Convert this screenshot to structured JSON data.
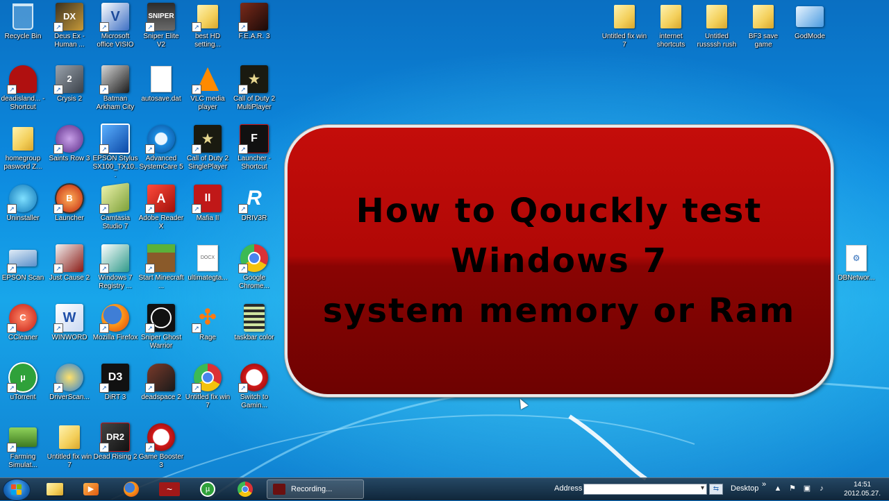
{
  "desktop": {
    "banner_lines": [
      "How to Qouckly test",
      "Windows 7",
      "system memory or Ram"
    ],
    "icons": [
      {
        "label": "Recycle Bin",
        "icon": "recycle-bin-icon"
      },
      {
        "label": "Deus Ex - Human ...",
        "icon": "deus-ex-icon"
      },
      {
        "label": "Microsoft office VISIO",
        "icon": "visio-icon"
      },
      {
        "label": "Sniper Elite V2",
        "icon": "sniper-elite-icon"
      },
      {
        "label": "best HD setting...",
        "icon": "folder-icon"
      },
      {
        "label": "F.E.A.R. 3",
        "icon": "fear3-icon"
      },
      {
        "label": "deadisland... - Shortcut",
        "icon": "deadisland-icon"
      },
      {
        "label": "Crysis 2",
        "icon": "crysis2-icon"
      },
      {
        "label": "Batman Arkham City",
        "icon": "batman-icon"
      },
      {
        "label": "autosave.dat",
        "icon": "file-icon"
      },
      {
        "label": "VLC media player",
        "icon": "vlc-icon"
      },
      {
        "label": "Call of Duty 2 MultiPlayer",
        "icon": "cod2-icon"
      },
      {
        "label": "homegroup pasword Z...",
        "icon": "folder-icon"
      },
      {
        "label": "Saints Row 3",
        "icon": "saints-row-icon"
      },
      {
        "label": "EPSON Stylus SX100_TX10...",
        "icon": "epson-icon"
      },
      {
        "label": "Advanced SystemCare 5",
        "icon": "systemcare-icon"
      },
      {
        "label": "Call of Duty 2 SinglePlayer",
        "icon": "cod2-icon"
      },
      {
        "label": "Launcher - Shortcut",
        "icon": "launcher-icon"
      },
      {
        "label": "Uninstaller",
        "icon": "uninstaller-icon"
      },
      {
        "label": "Launcher",
        "icon": "launcher-icon"
      },
      {
        "label": "Camtasia Studio 7",
        "icon": "camtasia-icon"
      },
      {
        "label": "Adobe Reader X",
        "icon": "adobe-reader-icon"
      },
      {
        "label": "Mafia II",
        "icon": "mafia-icon"
      },
      {
        "label": "DRIV3R",
        "icon": "driver-icon"
      },
      {
        "label": "EPSON Scan",
        "icon": "epson-scan-icon"
      },
      {
        "label": "Just Cause 2",
        "icon": "just-cause-icon"
      },
      {
        "label": "Windows 7 Registry ...",
        "icon": "registry-icon"
      },
      {
        "label": "Start Minecraft ...",
        "icon": "minecraft-icon"
      },
      {
        "label": "ultimategta...",
        "icon": "docx-icon"
      },
      {
        "label": "Google Chrome...",
        "icon": "chrome-icon"
      },
      {
        "label": "CCleaner",
        "icon": "ccleaner-icon"
      },
      {
        "label": "WINWORD",
        "icon": "word-icon"
      },
      {
        "label": "Mozilla Firefox",
        "icon": "firefox-icon"
      },
      {
        "label": "Sniper Ghost Warrior",
        "icon": "sniper-ghost-icon"
      },
      {
        "label": "Rage",
        "icon": "rage-icon"
      },
      {
        "label": "taskbar color",
        "icon": "film-icon"
      },
      {
        "label": "uTorrent",
        "icon": "utorrent-icon"
      },
      {
        "label": "DriverScan...",
        "icon": "driverscan-icon"
      },
      {
        "label": "DiRT 3",
        "icon": "dirt3-icon"
      },
      {
        "label": "deadspace 2",
        "icon": "deadspace-icon"
      },
      {
        "label": "Untitled fix win 7",
        "icon": "chrome-icon"
      },
      {
        "label": "Switch to Gamin...",
        "icon": "game-booster-icon"
      },
      {
        "label": "Farming Simulat...",
        "icon": "farming-icon"
      },
      {
        "label": "Untitled fix win 7",
        "icon": "folder-icon"
      },
      {
        "label": "Dead Rising 2",
        "icon": "dead-rising-icon"
      },
      {
        "label": "Game Booster 3",
        "icon": "game-booster-icon"
      },
      {
        "label": "Untitled fix win 7",
        "icon": "folder-icon"
      },
      {
        "label": "internet shortcuts",
        "icon": "folder-icon"
      },
      {
        "label": "Untitled russssh rush",
        "icon": "folder-icon"
      },
      {
        "label": "BF3 save game",
        "icon": "folder-icon"
      },
      {
        "label": "GodMode",
        "icon": "control-panel-icon"
      },
      {
        "label": "DBNetwor...",
        "icon": "network-file-icon"
      }
    ]
  },
  "taskbar": {
    "recording_label": "Recording...",
    "address_label": "Address",
    "address_value": "",
    "desktop_label": "Desktop",
    "overflow_glyph": "»",
    "time": "14:51",
    "date": "2012.05.27."
  },
  "colors": {
    "banner_red": "#b00806",
    "desktop_blue": "#0d8be0"
  }
}
